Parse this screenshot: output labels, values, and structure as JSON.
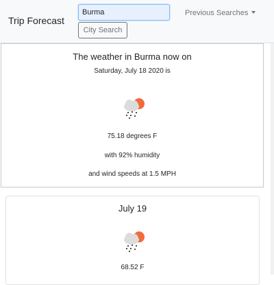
{
  "navbar": {
    "brand": "Trip Forecast",
    "search": {
      "value": "Burma",
      "placeholder": ""
    },
    "search_button": "City Search",
    "previous_searches": "Previous Searches"
  },
  "current": {
    "heading": "The weather in Burma now on",
    "date_line": "Saturday, July 18 2020 is",
    "icon": "rain-cloud-sun-icon",
    "temperature": "75.18 degrees F",
    "humidity": "with 92% humidity",
    "wind": "and wind speeds at 1.5 MPH"
  },
  "forecast": [
    {
      "day": "July 19",
      "icon": "rain-cloud-sun-icon",
      "temperature": "68.52 F"
    }
  ],
  "colors": {
    "sun": "#f26b3a",
    "cloud": "#dcdcdc",
    "rain": "#4a4a4a",
    "navbar_bg": "#f8f9fa",
    "input_bg": "#e8f0fe",
    "input_border": "#80bdff"
  }
}
